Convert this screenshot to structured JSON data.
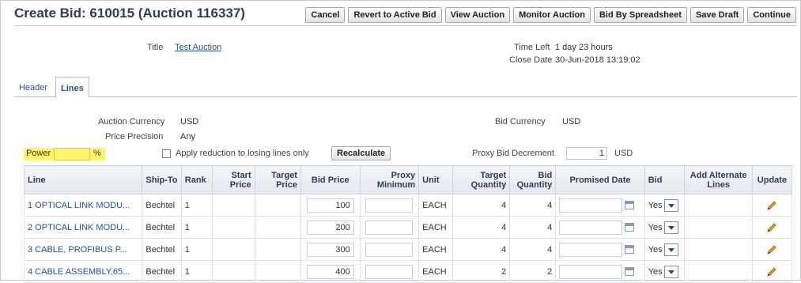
{
  "page": {
    "title": "Create Bid: 610015 (Auction 116337)"
  },
  "toolbar": {
    "cancel": "Cancel",
    "revert": "Revert to Active Bid",
    "view_auction": "View Auction",
    "monitor_auction": "Monitor Auction",
    "bid_by_spreadsheet": "Bid By Spreadsheet",
    "save_draft": "Save Draft",
    "continue": "Continue"
  },
  "summary": {
    "title_label": "Title",
    "title_value": "Test Auction",
    "time_left_label": "Time Left",
    "time_left_value": "1 day 23 hours",
    "close_date_label": "Close Date",
    "close_date_value": "30-Jun-2018 13:19:02"
  },
  "tabs": [
    {
      "label": "Header"
    },
    {
      "label": "Lines"
    }
  ],
  "lines_info": {
    "auction_currency_label": "Auction Currency",
    "auction_currency_value": "USD",
    "price_precision_label": "Price Precision",
    "price_precision_value": "Any",
    "bid_currency_label": "Bid Currency",
    "bid_currency_value": "USD",
    "power_bid_label": "Power Bid",
    "power_bid_unit": "%",
    "apply_reduction_label": "Apply reduction to losing lines only",
    "recalculate": "Recalculate",
    "proxy_decrement_label": "Proxy Bid Decrement",
    "proxy_decrement_value": "1",
    "proxy_decrement_currency": "USD",
    "highlight_color": "#fff46b"
  },
  "table": {
    "headers": {
      "line": "Line",
      "ship_to": "Ship-To",
      "rank": "Rank",
      "start_price": "Start Price",
      "target_price": "Target Price",
      "bid_price": "Bid Price",
      "proxy_minimum": "Proxy Minimum",
      "unit": "Unit",
      "target_quantity": "Target Quantity",
      "bid_quantity": "Bid Quantity",
      "promised_date": "Promised Date",
      "bid": "Bid",
      "add_alternate_lines": "Add Alternate Lines",
      "update": "Update"
    },
    "rows": [
      {
        "line": "1 OPTICAL LINK MODU...",
        "ship_to": "Bechtel",
        "rank": "1",
        "start_price": "",
        "target_price": "",
        "bid_price": "100",
        "proxy_minimum": "",
        "unit": "EACH",
        "target_quantity": "4",
        "bid_quantity": "4",
        "bid": "Yes"
      },
      {
        "line": "2 OPTICAL LINK MODU...",
        "ship_to": "Bechtel",
        "rank": "1",
        "start_price": "",
        "target_price": "",
        "bid_price": "200",
        "proxy_minimum": "",
        "unit": "EACH",
        "target_quantity": "4",
        "bid_quantity": "4",
        "bid": "Yes"
      },
      {
        "line": "3 CABLE, PROFIBUS P...",
        "ship_to": "Bechtel",
        "rank": "1",
        "start_price": "",
        "target_price": "",
        "bid_price": "300",
        "proxy_minimum": "",
        "unit": "EACH",
        "target_quantity": "4",
        "bid_quantity": "4",
        "bid": "Yes"
      },
      {
        "line": "4 CABLE ASSEMBLY,65...",
        "ship_to": "Bechtel",
        "rank": "1",
        "start_price": "",
        "target_price": "",
        "bid_price": "400",
        "proxy_minimum": "",
        "unit": "EACH",
        "target_quantity": "2",
        "bid_quantity": "2",
        "bid": "Yes"
      }
    ]
  },
  "icons": {
    "calendar": "calendar-icon",
    "pencil": "pencil-icon",
    "dropdown": "chevron-down-icon"
  }
}
